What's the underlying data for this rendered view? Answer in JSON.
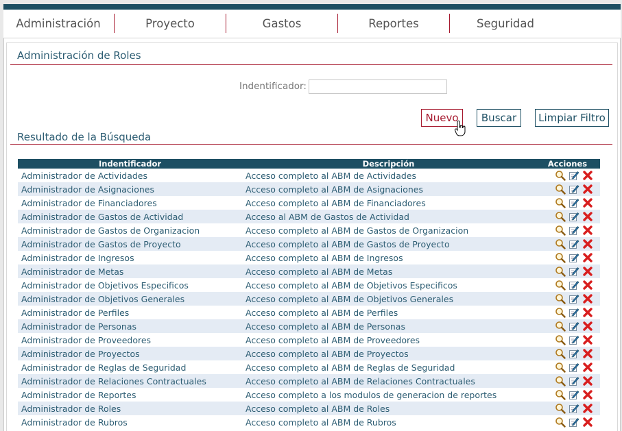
{
  "nav": {
    "items": [
      "Administración",
      "Proyecto",
      "Gastos",
      "Reportes",
      "Seguridad"
    ]
  },
  "page": {
    "title": "Administración de Roles",
    "results_title": "Resultado de la Búsqueda"
  },
  "filter": {
    "label": "Indentificador:",
    "value": ""
  },
  "buttons": {
    "nuevo": "Nuevo",
    "buscar": "Buscar",
    "limpiar": "Limpiar Filtro"
  },
  "table": {
    "columns": [
      "Indentificador",
      "Descripción",
      "Acciones"
    ],
    "rows": [
      [
        "Administrador de Actividades",
        "Acceso completo al ABM de Actividades"
      ],
      [
        "Administrador de Asignaciones",
        "Acceso completo al ABM de Asignaciones"
      ],
      [
        "Administrador de Financiadores",
        "Acceso completo al ABM de Financiadores"
      ],
      [
        "Administrador de Gastos de Actividad",
        "Acceso al ABM de Gastos de Actividad"
      ],
      [
        "Administrador de Gastos de Organizacion",
        "Acceso completo al ABM de Gastos de Organizacion"
      ],
      [
        "Administrador de Gastos de Proyecto",
        "Acceso completo al ABM de Gastos de Proyecto"
      ],
      [
        "Administrador de Ingresos",
        "Acceso completo al ABM de Ingresos"
      ],
      [
        "Administrador de Metas",
        "Acceso completo al ABM de Metas"
      ],
      [
        "Administrador de Objetivos Especificos",
        "Acceso completo al ABM de Objetivos Especificos"
      ],
      [
        "Administrador de Objetivos Generales",
        "Acceso completo al ABM de Objetivos Generales"
      ],
      [
        "Administrador de Perfiles",
        "Acceso completo al ABM de Perfiles"
      ],
      [
        "Administrador de Personas",
        "Acceso completo al ABM de Personas"
      ],
      [
        "Administrador de Proveedores",
        "Acceso completo al ABM de Proveedores"
      ],
      [
        "Administrador de Proyectos",
        "Acceso completo al ABM de Proyectos"
      ],
      [
        "Administrador de Reglas de Seguridad",
        "Acceso completo al ABM de Reglas de Seguridad"
      ],
      [
        "Administrador de Relaciones Contractuales",
        "Acceso completo al ABM de Relaciones Contractuales"
      ],
      [
        "Administrador de Reportes",
        "Acceso completo a los modulos de generacion de reportes"
      ],
      [
        "Administrador de Roles",
        "Acceso completo al ABM de Roles"
      ],
      [
        "Administrador de Rubros",
        "Acceso completo al ABM de Rubros"
      ]
    ],
    "row_actions": [
      "view-icon",
      "edit-icon",
      "delete-icon"
    ]
  },
  "colors": {
    "header_blue": "#1d4f63",
    "accent_red": "#a6192e",
    "row_alt": "#e4ebf4",
    "text_blue": "#2d5d73"
  }
}
